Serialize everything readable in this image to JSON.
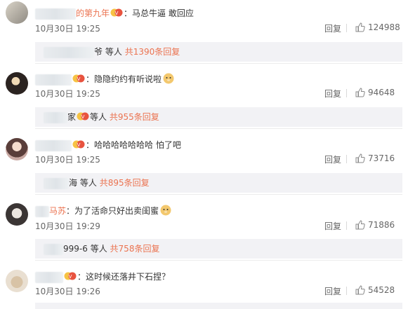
{
  "comments": [
    {
      "name_suffix": "的第九年",
      "text": "：马总牛逼 敢回应",
      "emoji": "",
      "time": "10月30日 19:25",
      "reply_label": "回复",
      "likes": "124988",
      "sub": {
        "name_suffix": "爷",
        "others": "等人",
        "more": "共1390条回复"
      }
    },
    {
      "name_suffix": "",
      "text": "：隐隐约约有听说啦",
      "emoji": "doge",
      "time": "10月30日 19:25",
      "reply_label": "回复",
      "likes": "94648",
      "sub": {
        "name_suffix": "家",
        "others": "等人",
        "more": "共955条回复"
      }
    },
    {
      "name_suffix": "",
      "text": "：哈哈哈哈哈哈哈 怕了吧",
      "emoji": "",
      "time": "10月30日 19:25",
      "reply_label": "回复",
      "likes": "73716",
      "sub": {
        "name_suffix": "海",
        "others": "等人",
        "more": "共895条回复"
      }
    },
    {
      "name_suffix": "马苏",
      "text": "：为了活命只好出卖闺蜜",
      "emoji": "doge",
      "time": "10月30日 19:29",
      "reply_label": "回复",
      "likes": "71886",
      "sub": {
        "name_suffix": "999-6",
        "others": "等人",
        "more": "共758条回复"
      }
    },
    {
      "name_suffix": "",
      "text": "：这时候还落井下石捏？",
      "emoji": "",
      "time": "10月30日 19:26",
      "reply_label": "回复",
      "likes": "54528"
    }
  ],
  "icons": {
    "like": "thumbs-up-icon",
    "vip": "vip-badge-icon",
    "emoji": "doge-emoji-icon"
  },
  "colors": {
    "accent": "#eb7350",
    "subBg": "#f2f2f5"
  }
}
